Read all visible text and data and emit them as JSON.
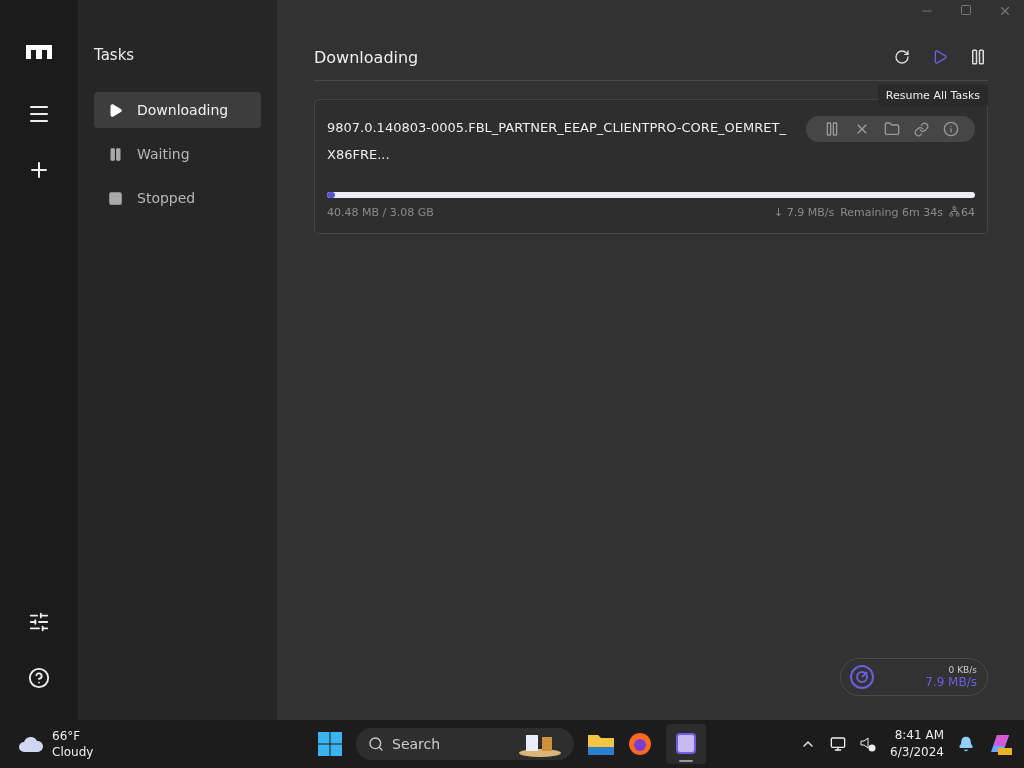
{
  "sidebar": {
    "title": "Tasks",
    "items": [
      {
        "label": "Downloading",
        "kind": "play",
        "selected": true
      },
      {
        "label": "Waiting",
        "kind": "pause",
        "selected": false
      },
      {
        "label": "Stopped",
        "kind": "stop",
        "selected": false
      }
    ]
  },
  "main": {
    "title": "Downloading",
    "tooltip": "Resume All Tasks",
    "tasks": [
      {
        "name": "9807.0.140803-0005.FBL_PARTNER_EEAP_CLIENTPRO-CORE_OEMRET_X86FRE...",
        "level": 0.013,
        "size": "40.48 MB / 3.08 GB",
        "speed": "↓ 7.9 MB/s",
        "remaining": "Remaining 6m 34s",
        "connections": "64"
      }
    ]
  },
  "speed_widget": {
    "upload": "0 KB/s",
    "download": "7.9 MB/s"
  },
  "taskbar": {
    "temperature": "66°F",
    "weather": "Cloudy",
    "search": "Search",
    "time": "8:41 AM",
    "date": "6/3/2024"
  }
}
